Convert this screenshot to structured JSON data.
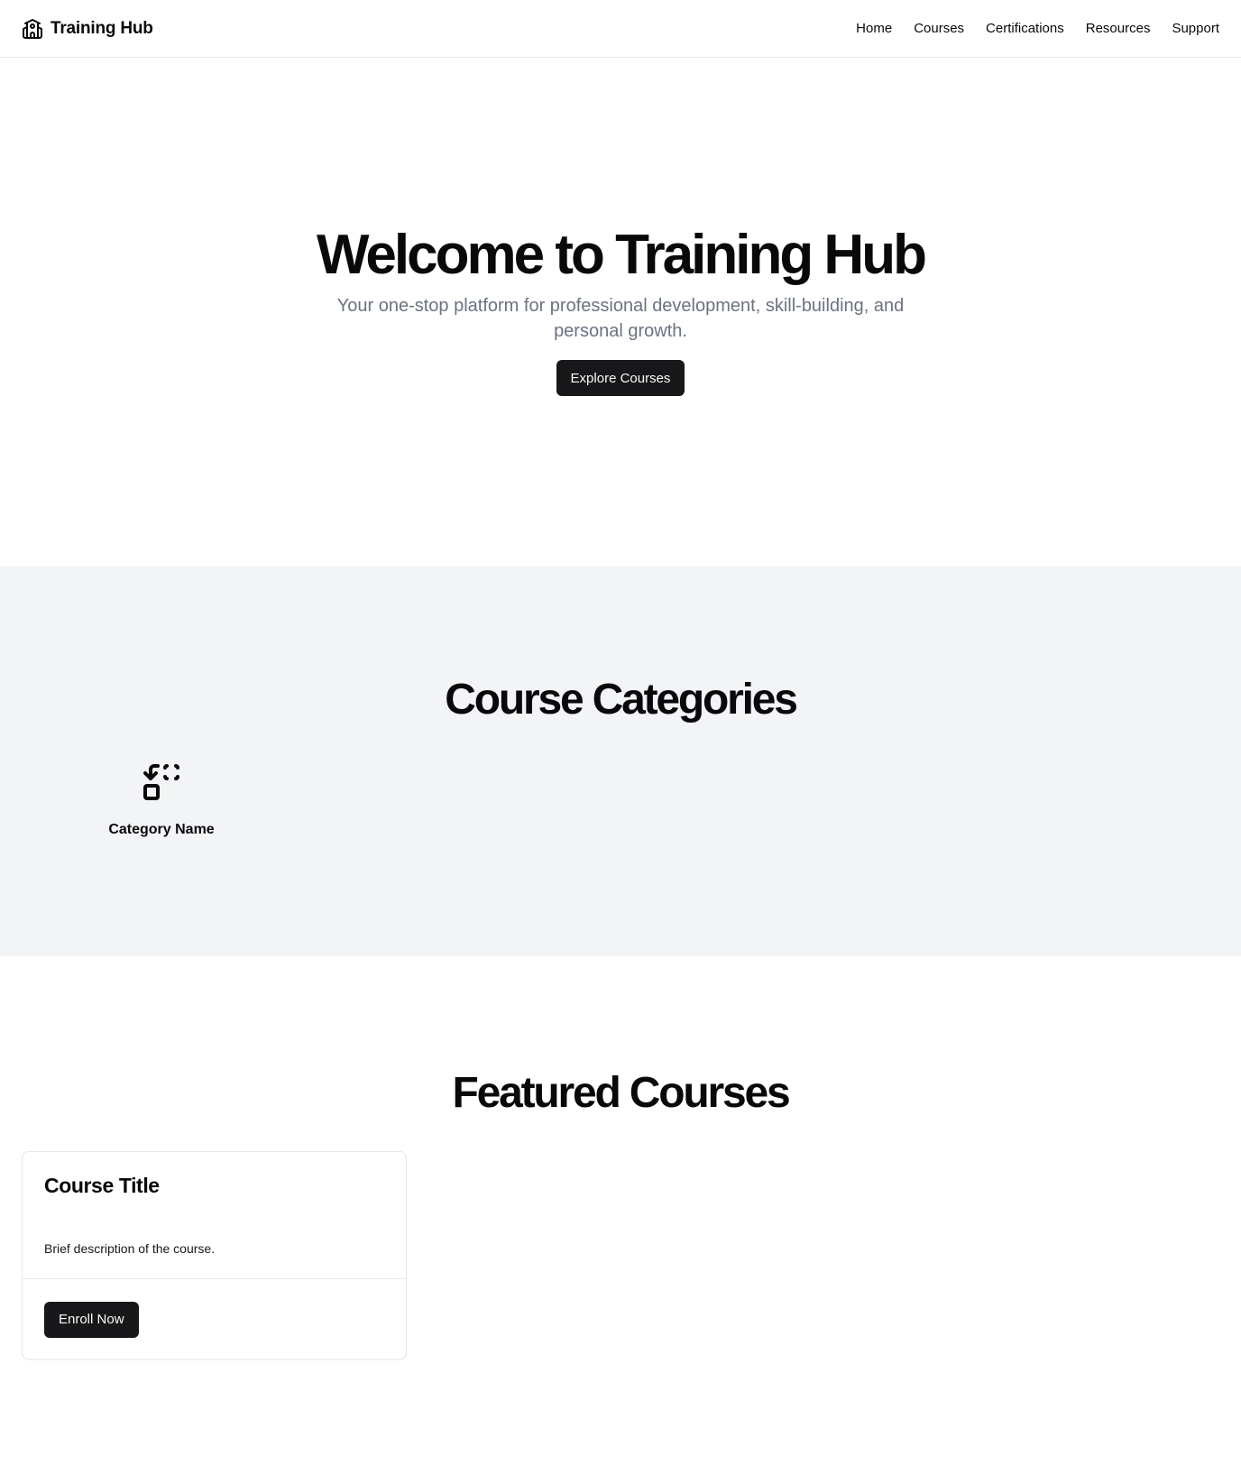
{
  "header": {
    "brand_name": "Training Hub",
    "brand_icon": "school-building-icon",
    "nav": [
      {
        "label": "Home"
      },
      {
        "label": "Courses"
      },
      {
        "label": "Certifications"
      },
      {
        "label": "Resources"
      },
      {
        "label": "Support"
      }
    ]
  },
  "hero": {
    "title": "Welcome to Training Hub",
    "subtitle": "Your one-stop platform for professional development, skill-building, and personal growth.",
    "cta_label": "Explore Courses"
  },
  "categories": {
    "title": "Course Categories",
    "items": [
      {
        "name": "Category Name",
        "icon": "swap-squares-icon"
      }
    ]
  },
  "featured": {
    "title": "Featured Courses",
    "courses": [
      {
        "title": "Course Title",
        "description": "Brief description of the course.",
        "cta_label": "Enroll Now"
      }
    ]
  },
  "colors": {
    "primary": "#18181b",
    "muted_text": "#6b7280",
    "section_bg": "#f3f4f6",
    "border": "#e5e7eb"
  }
}
